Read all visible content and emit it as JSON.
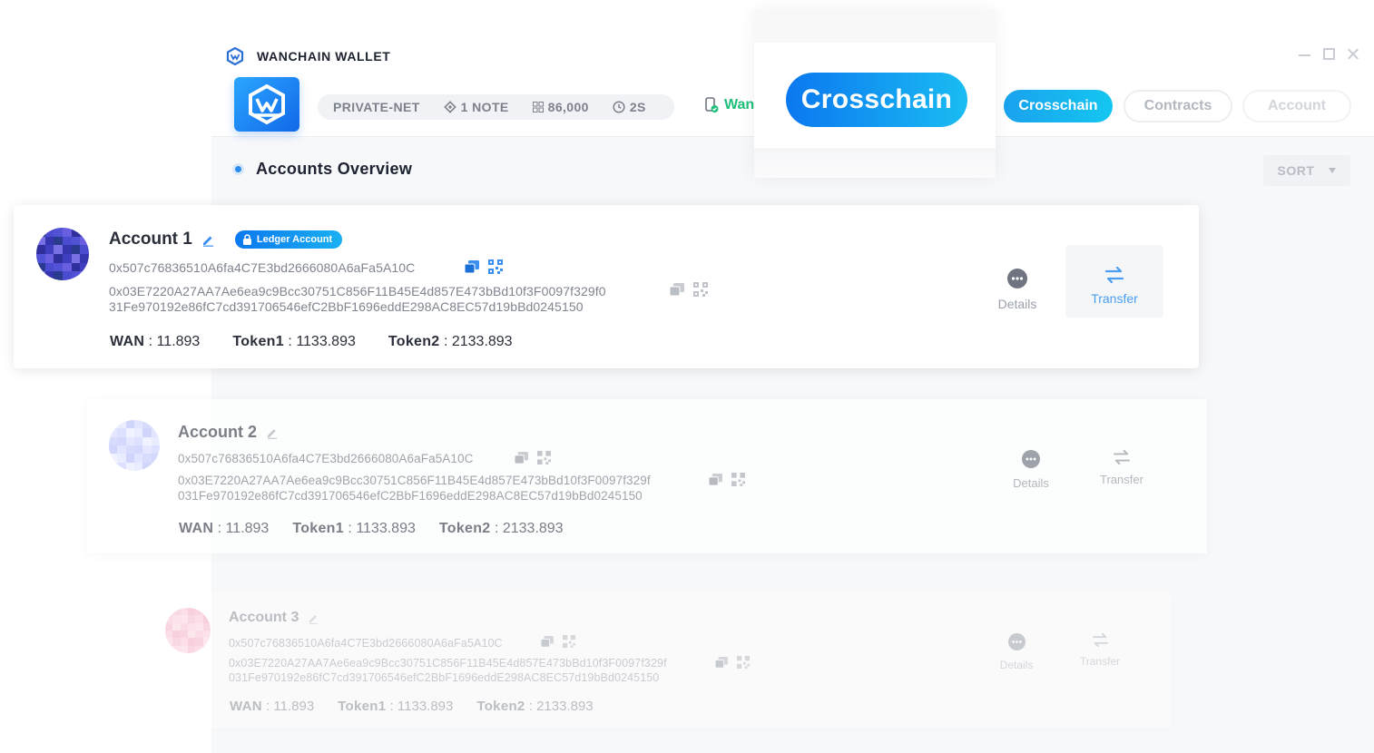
{
  "window": {
    "title": "WANCHAIN WALLET"
  },
  "header": {
    "network": "PRIVATE-NET",
    "nodes": "1 NOTE",
    "block": "86,000",
    "time": "2S",
    "wan_label": "Wan",
    "tabs": [
      {
        "label": "Crosschain",
        "active": true
      },
      {
        "label": "Contracts",
        "active": false
      },
      {
        "label": "Account",
        "active": false
      }
    ]
  },
  "zoom": {
    "label": "Crosschain"
  },
  "overview": {
    "title": "Accounts Overview",
    "sort_label": "SORT"
  },
  "accounts": [
    {
      "name": "Account 1",
      "badge": "Ledger Account",
      "address": "0x507c76836510A6fa4C7E3bd2666080A6aFa5A10C",
      "pubkey_line1": "0x03E7220A27AA7Ae6ea9c9Bcc30751C856F11B45E4d857E473bBd10f3F0097f329f0",
      "pubkey_line2": "31Fe970192e86fC7cd391706546efC2BbF1696eddE298AC8EC57d19bBd0245150",
      "balances": [
        {
          "token": "WAN",
          "value": "11.893"
        },
        {
          "token": "Token1",
          "value": "1133.893"
        },
        {
          "token": "Token2",
          "value": "2133.893"
        }
      ],
      "details_label": "Details",
      "transfer_label": "Transfer"
    },
    {
      "name": "Account 2",
      "address": "0x507c76836510A6fa4C7E3bd2666080A6aFa5A10C",
      "pubkey_line1": "0x03E7220A27AA7Ae6ea9c9Bcc30751C856F11B45E4d857E473bBd10f3F0097f329f",
      "pubkey_line2": "031Fe970192e86fC7cd391706546efC2BbF1696eddE298AC8EC57d19bBd0245150",
      "balances": [
        {
          "token": "WAN",
          "value": "11.893"
        },
        {
          "token": "Token1",
          "value": "1133.893"
        },
        {
          "token": "Token2",
          "value": "2133.893"
        }
      ],
      "details_label": "Details",
      "transfer_label": "Transfer"
    },
    {
      "name": "Account 3",
      "address": "0x507c76836510A6fa4C7E3bd2666080A6aFa5A10C",
      "pubkey_line1": "0x03E7220A27AA7Ae6ea9c9Bcc30751C856F11B45E4d857E473bBd10f3F0097f329f",
      "pubkey_line2": "031Fe970192e86fC7cd391706546efC2BbF1696eddE298AC8EC57d19bBd0245150",
      "balances": [
        {
          "token": "WAN",
          "value": "11.893"
        },
        {
          "token": "Token1",
          "value": "1133.893"
        },
        {
          "token": "Token2",
          "value": "2133.893"
        }
      ],
      "details_label": "Details",
      "transfer_label": "Transfer"
    }
  ],
  "colors": {
    "accent": "#0b78f0",
    "accent_light": "#1abcf2",
    "online": "#1fbf7a"
  }
}
